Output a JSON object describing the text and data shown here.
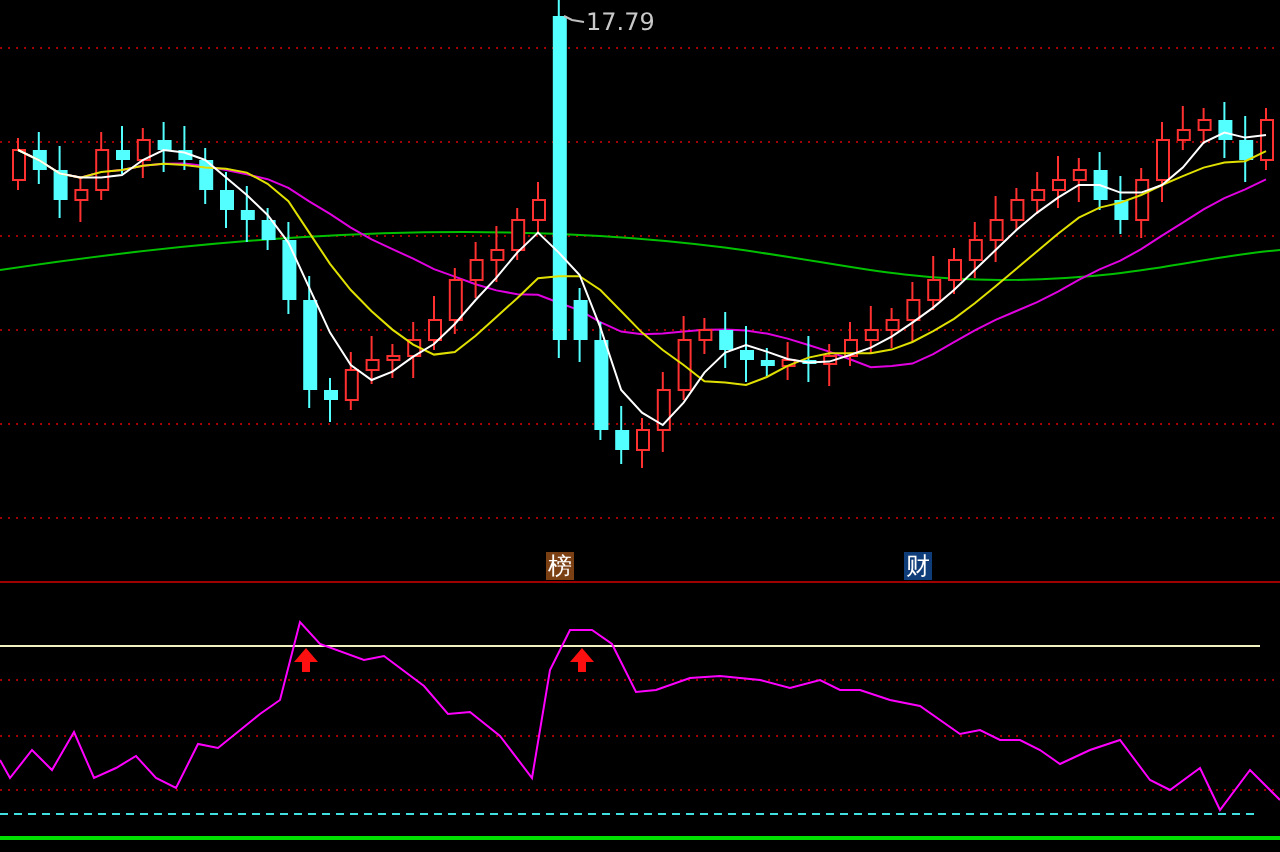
{
  "price_chart": {
    "high_label": "17.79"
  },
  "indicator_panel": {
    "badges": [
      {
        "text": "榜",
        "color": "#7a3f12"
      },
      {
        "text": "财",
        "color": "#0e3d7a"
      }
    ]
  }
}
